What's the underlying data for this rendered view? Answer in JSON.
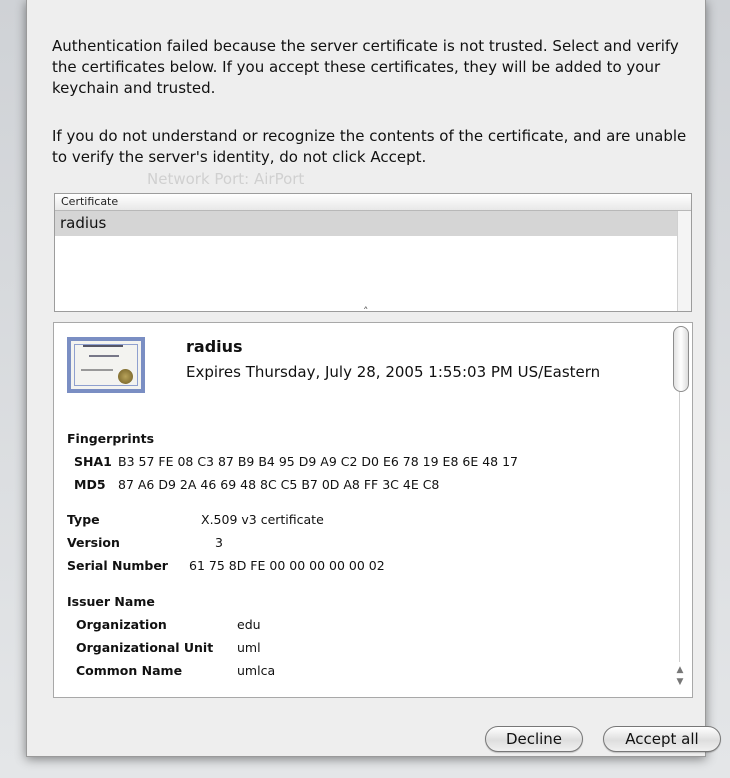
{
  "dialog": {
    "message1": "Authentication failed because the server certificate is not trusted.  Select and verify the certificates below. If you accept these certificates, they will be added to your keychain and trusted.",
    "message2": "If you do not understand or recognize the contents of the certificate, and are unable to verify the server's identity, do not click Accept."
  },
  "background": {
    "network_port_label": "Network Port:",
    "network_port_value": "AirPort"
  },
  "cert_list": {
    "header": "Certificate",
    "rows": [
      "radius"
    ]
  },
  "details": {
    "icon": "certificate-icon",
    "name": "radius",
    "expires": "Expires Thursday, July 28, 2005 1:55:03 PM US/Eastern",
    "fingerprints_label": "Fingerprints",
    "sha1_label": "SHA1",
    "sha1_value": "B3 57 FE 08 C3 87 B9 B4 95 D9 A9 C2 D0 E6 78 19 E8 6E 48 17",
    "md5_label": "MD5",
    "md5_value": "87 A6 D9 2A 46 69 48 8C C5 B7 0D A8 FF 3C 4E C8",
    "type_label": "Type",
    "type_value": "X.509 v3 certificate",
    "version_label": "Version",
    "version_value": "3",
    "serial_label": "Serial Number",
    "serial_value": "61 75 8D FE 00 00 00 00 00 02",
    "issuer_label": "Issuer Name",
    "org_label": "Organization",
    "org_value": "edu",
    "ou_label": "Organizational Unit",
    "ou_value": "uml",
    "cn_label": "Common Name",
    "cn_value": "umlca"
  },
  "buttons": {
    "decline": "Decline",
    "accept_all": "Accept all"
  }
}
